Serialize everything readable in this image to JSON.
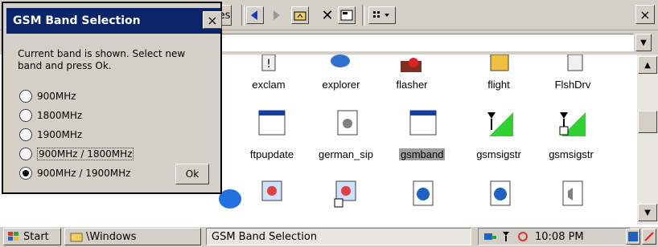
{
  "explorer": {
    "toolbar_partial_label": "es",
    "close_label": "×",
    "folder_icons": [
      {
        "name": "exclam"
      },
      {
        "name": "explorer"
      },
      {
        "name": "flasher"
      },
      {
        "name": "flight"
      },
      {
        "name": "FlshDrv"
      },
      {
        "name": "ftpupdate"
      },
      {
        "name": "german_sip"
      },
      {
        "name": "gsmband"
      },
      {
        "name": "gsmsigstr"
      },
      {
        "name": "gsmsigstr"
      }
    ]
  },
  "dialog": {
    "title": "GSM Band Selection",
    "close_label": "×",
    "message": "Current band is shown.  Select new band and press Ok.",
    "options": [
      {
        "label": "900MHz",
        "selected": false
      },
      {
        "label": "1800MHz",
        "selected": false
      },
      {
        "label": "1900MHz",
        "selected": false
      },
      {
        "label": "900MHz / 1800MHz",
        "selected": false
      },
      {
        "label": "900MHz / 1900MHz",
        "selected": true
      }
    ],
    "ok_label": "Ok"
  },
  "taskbar": {
    "start_label": "Start",
    "windows_label": "\\Windows",
    "active_label": "GSM Band Selection",
    "clock": "10:08 PM"
  }
}
